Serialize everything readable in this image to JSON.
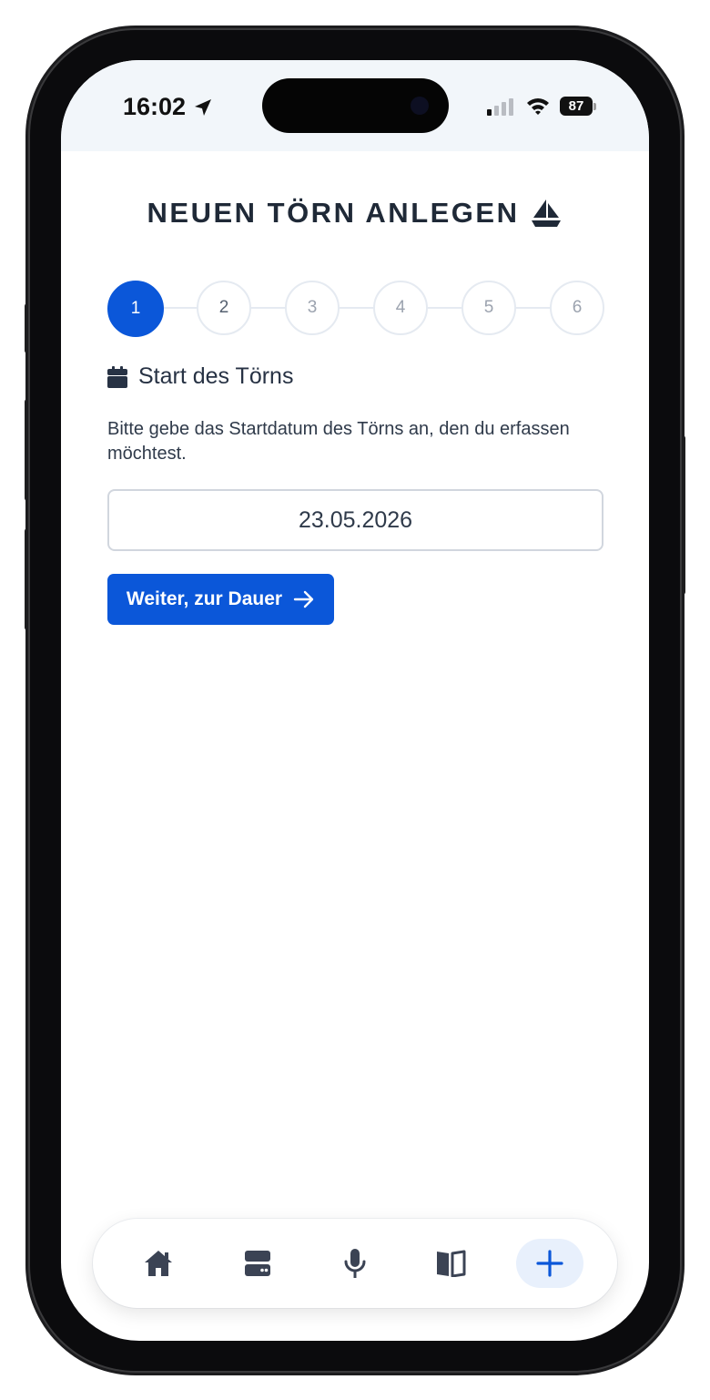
{
  "status_bar": {
    "time": "16:02",
    "battery": "87"
  },
  "page": {
    "title": "NEUEN TÖRN ANLEGEN",
    "title_icon": "sailboat-icon"
  },
  "stepper": {
    "steps": [
      "1",
      "2",
      "3",
      "4",
      "5",
      "6"
    ],
    "active_step": "1"
  },
  "section": {
    "icon": "calendar-icon",
    "heading": "Start des Törns",
    "description": "Bitte gebe das Startdatum des Törns an, den du erfassen möchtest."
  },
  "form": {
    "start_date_value": "23.05.2026",
    "next_button_label": "Weiter, zur Dauer",
    "next_button_icon": "arrow-right-icon"
  },
  "tab_bar": {
    "items": [
      {
        "icon": "home-icon"
      },
      {
        "icon": "server-icon"
      },
      {
        "icon": "microphone-icon"
      },
      {
        "icon": "book-icon"
      },
      {
        "icon": "plus-icon",
        "active": true
      }
    ]
  },
  "colors": {
    "accent": "#0b57d9",
    "text": "#1f2937",
    "tab_active_bg": "#e8f0fc"
  }
}
